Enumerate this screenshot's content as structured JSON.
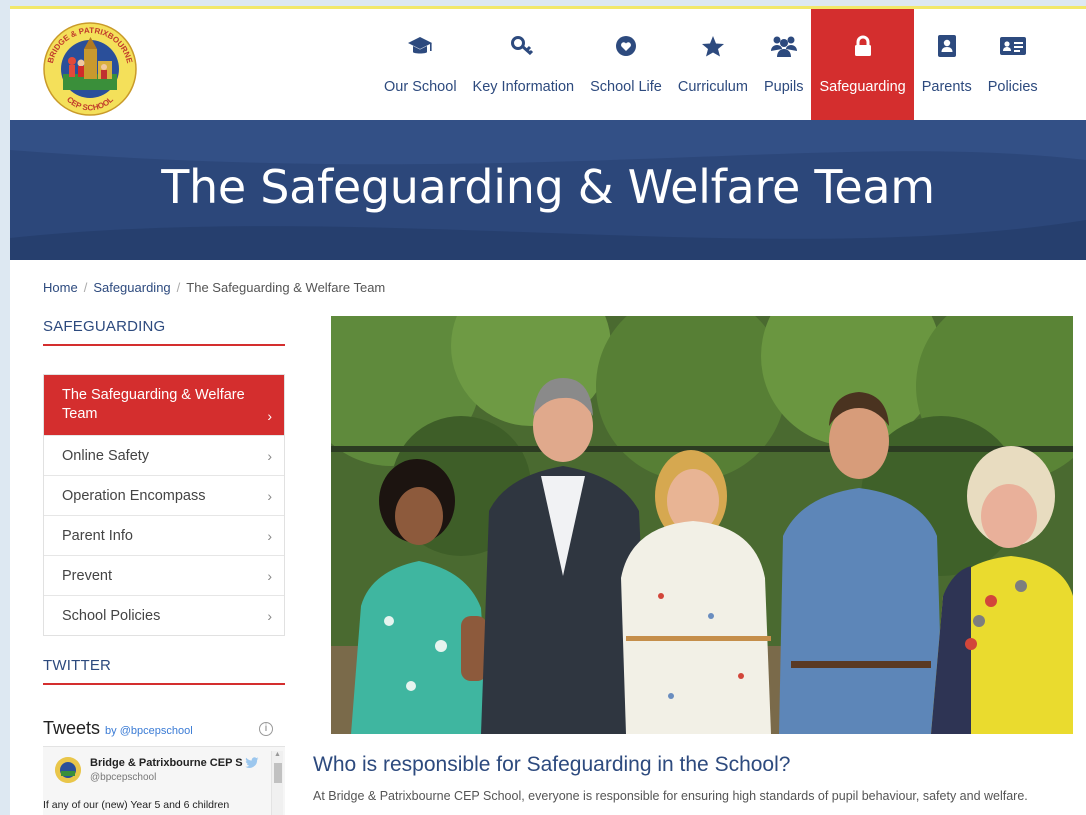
{
  "colors": {
    "brand_navy": "#2d4a7e",
    "accent_red": "#d42e2e",
    "page_bg": "#dde8f2"
  },
  "header": {
    "logo_alt": "Bridge & Patrixbourne CEP School logo",
    "logo_text_top": "BRIDGE & PATRIXBOURNE",
    "logo_text_bottom": "CEP SCHOOL",
    "nav": [
      {
        "label": "Our School",
        "icon": "graduation-cap-icon"
      },
      {
        "label": "Key Information",
        "icon": "key-icon"
      },
      {
        "label": "School Life",
        "icon": "heart-icon"
      },
      {
        "label": "Curriculum",
        "icon": "star-icon"
      },
      {
        "label": "Pupils",
        "icon": "users-icon"
      },
      {
        "label": "Safeguarding",
        "icon": "lock-icon",
        "active": true
      },
      {
        "label": "Parents",
        "icon": "address-book-icon"
      },
      {
        "label": "Policies",
        "icon": "id-card-icon"
      }
    ]
  },
  "hero": {
    "title": "The Safeguarding & Welfare Team"
  },
  "breadcrumb": {
    "home": "Home",
    "section": "Safeguarding",
    "current": "The Safeguarding & Welfare Team",
    "separator": "/"
  },
  "sidebar": {
    "heading": "SAFEGUARDING",
    "items": [
      {
        "label": "The Safeguarding & Welfare Team",
        "active": true
      },
      {
        "label": "Online Safety"
      },
      {
        "label": "Operation Encompass"
      },
      {
        "label": "Parent Info"
      },
      {
        "label": "Prevent"
      },
      {
        "label": "School Policies"
      }
    ],
    "chevron": "›",
    "twitter_heading": "TWITTER"
  },
  "twitter_widget": {
    "title": "Tweets",
    "by": "by @bpcepschool",
    "info": "i",
    "account_name": "Bridge & Patrixbourne CEP S",
    "handle": "@bpcepschool",
    "tweet_text": "If any of our (new) Year 5 and 6 children"
  },
  "main": {
    "photo_alt": "The Safeguarding & Welfare Team group photo",
    "heading": "Who is responsible for Safeguarding in the School?",
    "paragraph": "At Bridge & Patrixbourne CEP School, everyone is responsible for ensuring high standards of pupil behaviour, safety and welfare."
  }
}
